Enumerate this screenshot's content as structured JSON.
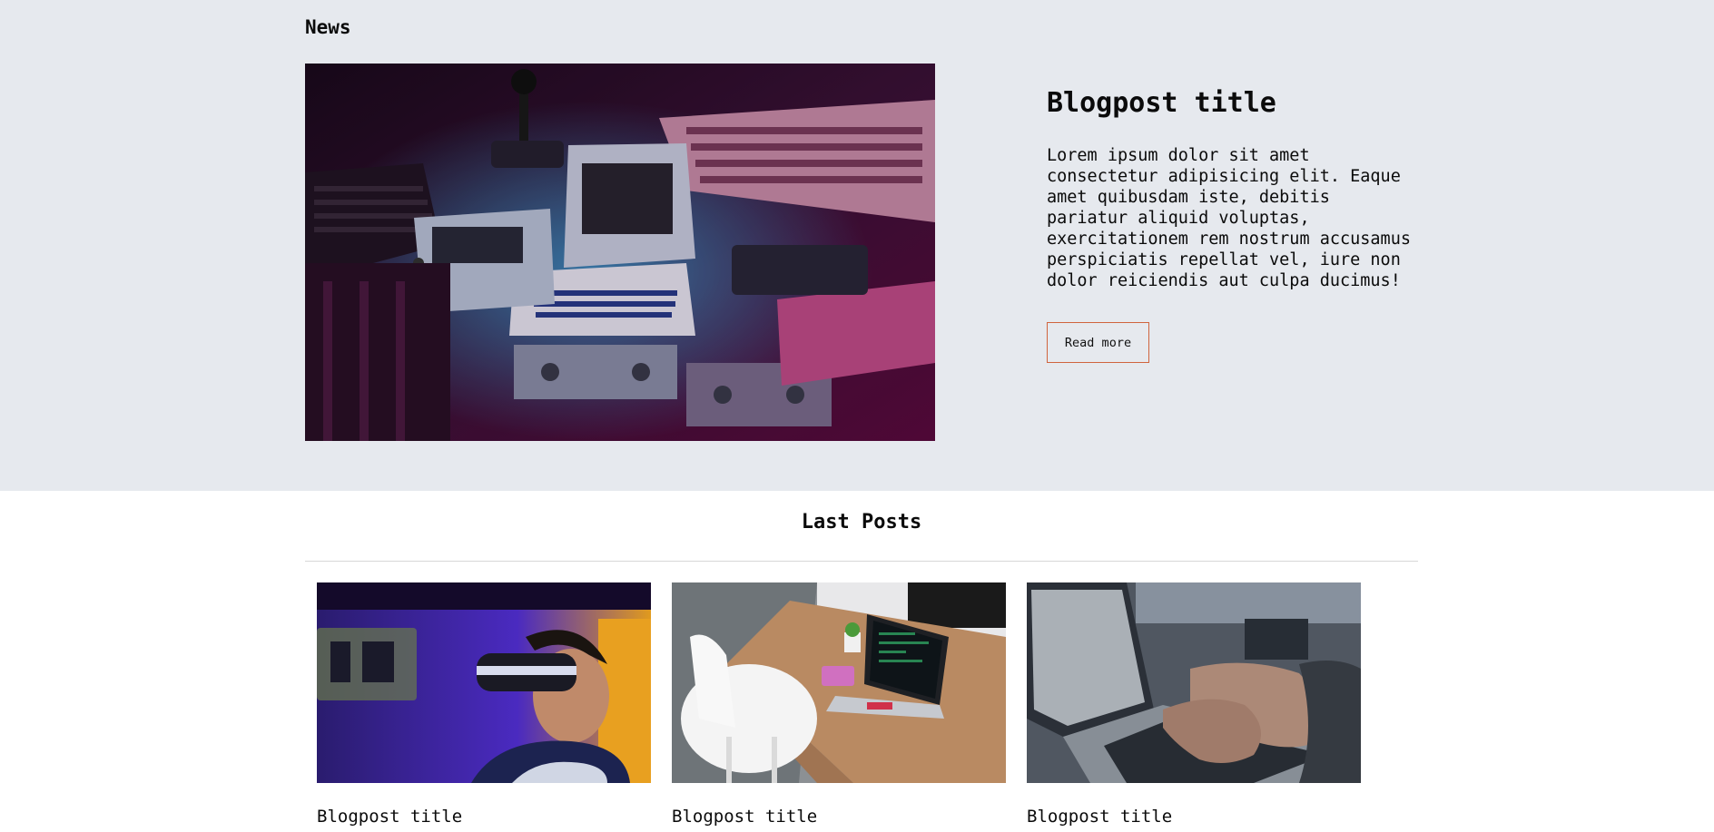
{
  "news": {
    "section_label": "News",
    "featured": {
      "title": "Blogpost title",
      "excerpt": "Lorem ipsum dolor sit amet consectetur adipisicing elit. Eaque amet quibusdam iste, debitis pariatur aliquid voluptas, exercitationem rem nostrum accusamus perspiciatis repellat vel, iure non dolor reiciendis aut culpa ducimus!",
      "read_more_label": "Read more"
    }
  },
  "last_posts": {
    "title": "Last Posts",
    "posts": [
      {
        "title": "Blogpost title"
      },
      {
        "title": "Blogpost title"
      },
      {
        "title": "Blogpost title"
      }
    ]
  },
  "colors": {
    "news_background": "#e6e9ee",
    "button_border": "#d0643e",
    "divider": "#d8d8d8"
  }
}
